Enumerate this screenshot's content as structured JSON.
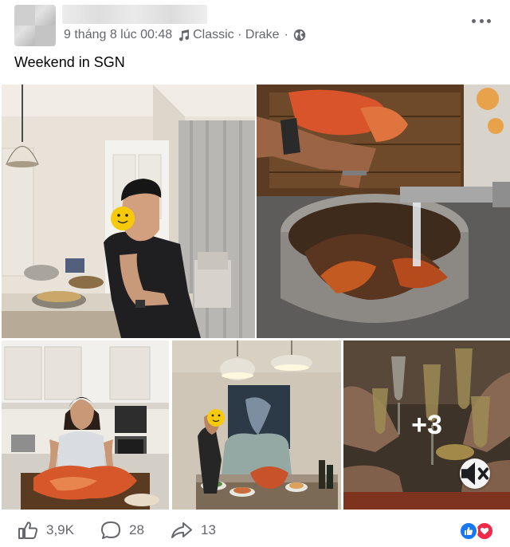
{
  "post": {
    "timestamp": "9 tháng 8 lúc 00:48",
    "music_label": "Classic · Drake",
    "separator": "·",
    "caption": "Weekend in SGN",
    "more_photos_label": "+3"
  },
  "stats": {
    "likes": "3,9K",
    "comments": "28",
    "shares": "13"
  },
  "icons": {
    "music": "music-note-icon",
    "privacy": "globe-icon",
    "menu": "more-dots-icon",
    "mute": "speaker-muted-icon",
    "like": "thumbs-up-icon",
    "comment": "comment-bubble-icon",
    "share": "share-arrow-icon"
  },
  "colors": {
    "meta_text": "#65676b",
    "like_blue": "#1877f2",
    "love_red": "#f02849"
  }
}
